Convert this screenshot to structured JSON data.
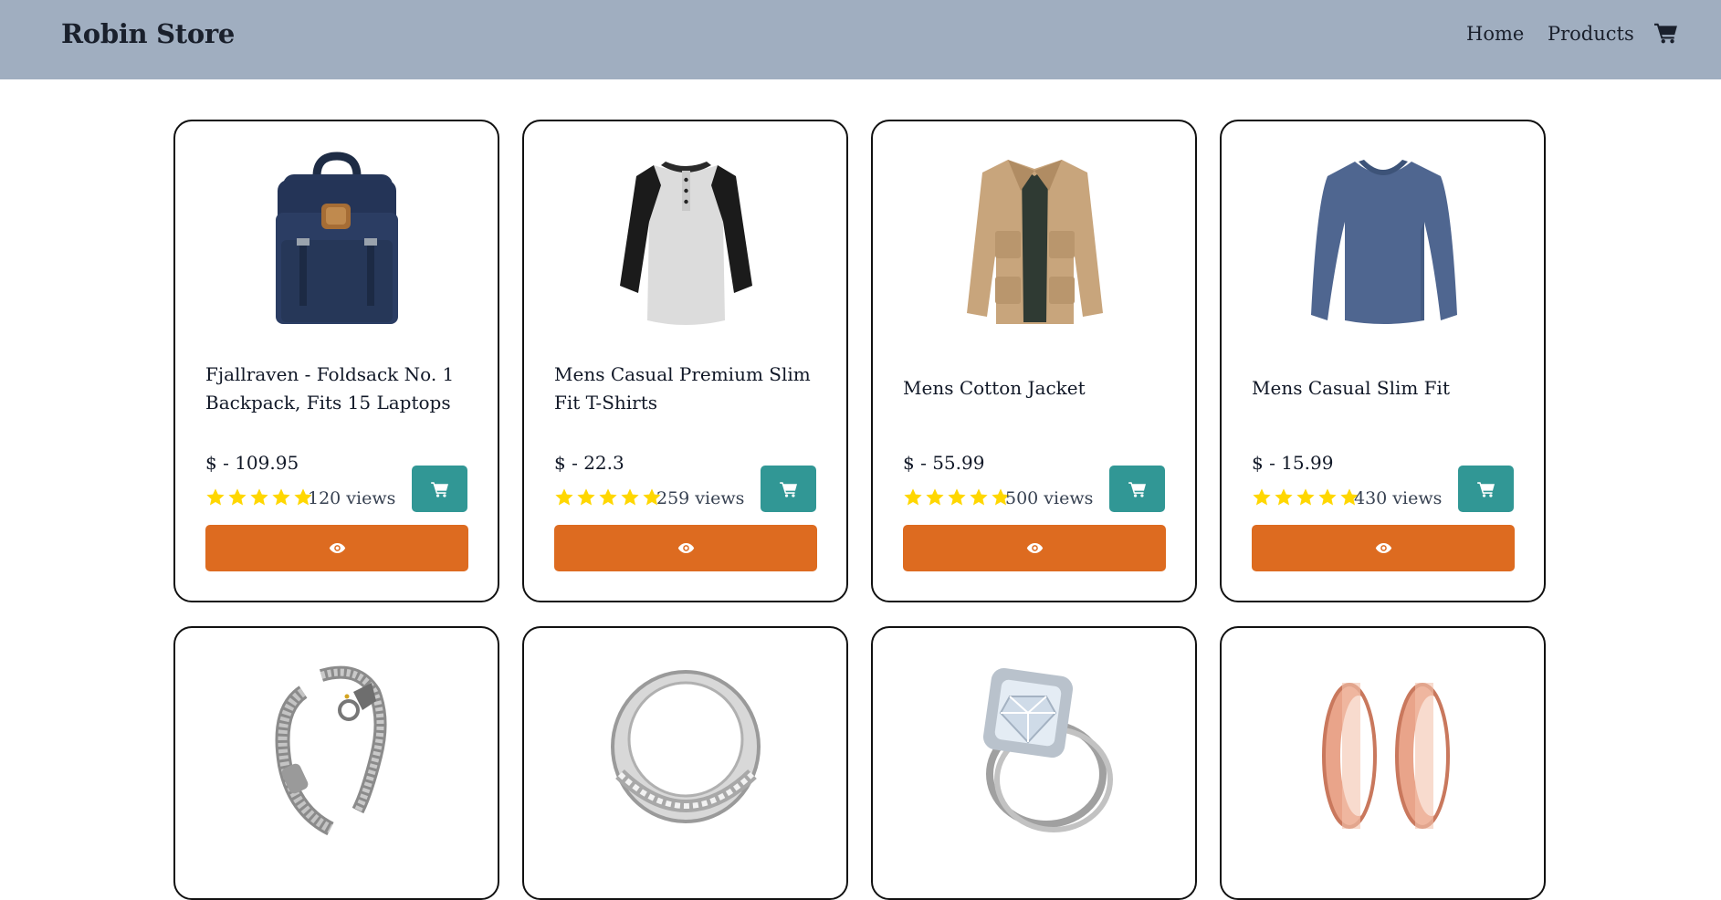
{
  "header": {
    "brand": "Robin Store",
    "nav": {
      "home": "Home",
      "products": "Products"
    },
    "cart_icon": "shopping-cart-icon",
    "background": "#a0aec0"
  },
  "colors": {
    "cart_button": "#319795",
    "view_button": "#dd6b20",
    "star": "#ffd700"
  },
  "products": [
    {
      "title": "Fjallraven - Foldsack No. 1 Backpack, Fits 15 Laptops",
      "price": "$ - 109.95",
      "rating": 5,
      "views": "120 views",
      "image": "backpack"
    },
    {
      "title": "Mens Casual Premium Slim Fit T-Shirts",
      "price": "$ - 22.3",
      "rating": 5,
      "views": "259 views",
      "image": "raglan-tshirt"
    },
    {
      "title": "Mens Cotton Jacket",
      "price": "$ - 55.99",
      "rating": 5,
      "views": "500 views",
      "image": "cotton-jacket"
    },
    {
      "title": "Mens Casual Slim Fit",
      "price": "$ - 15.99",
      "rating": 5,
      "views": "430 views",
      "image": "long-sleeve-shirt"
    },
    {
      "image": "dragon-bracelet"
    },
    {
      "image": "silver-ring"
    },
    {
      "image": "diamond-ring-set"
    },
    {
      "image": "rose-gold-plugs"
    }
  ]
}
